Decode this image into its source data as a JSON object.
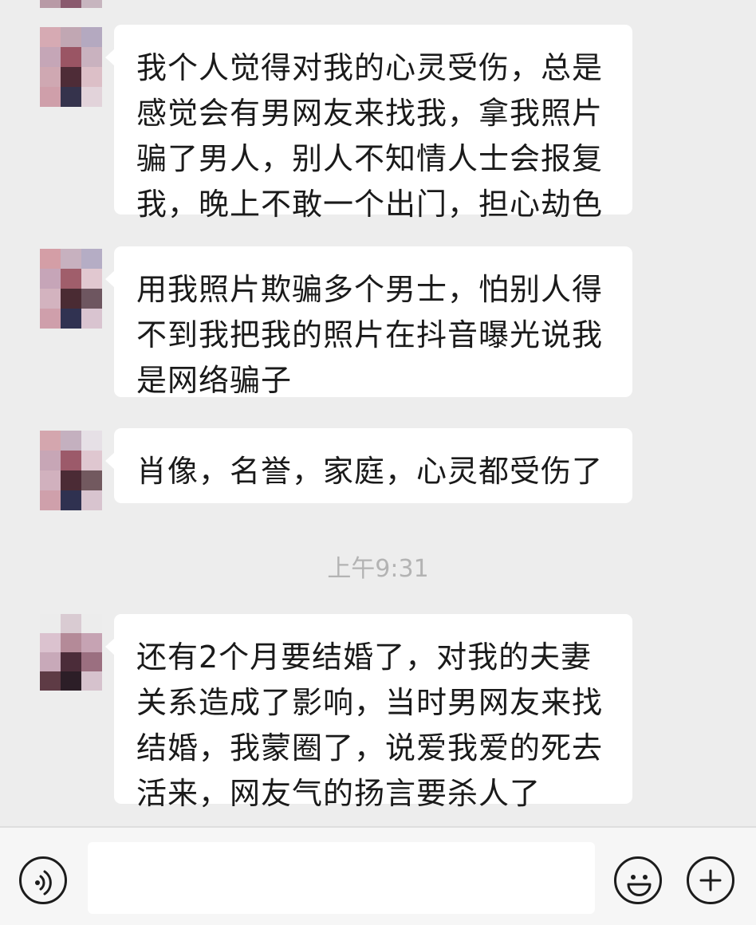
{
  "chat": {
    "messages": [
      {
        "text": "我个人觉得对我的心灵受伤，总是\n感觉会有男网友来找我，拿我照片\n骗了男人，别人不知情人士会报复\n我，晚上不敢一个出门，担心劫色"
      },
      {
        "text": "用我照片欺骗多个男士，怕别人得\n不到我把我的照片在抖音曝光说我\n是网络骗子"
      },
      {
        "text": "肖像，名誉，家庭，心灵都受伤了"
      },
      {
        "text": "还有2个月要结婚了，对我的夫妻\n关系造成了影响，当时男网友来找\n结婚，我蒙圈了，说爱我爱的死去\n活来，网友气的扬言要杀人了"
      }
    ],
    "timestamp": "上午9:31"
  },
  "input_bar": {
    "voice_icon": "voice-icon",
    "emoji_icon": "emoji-icon",
    "plus_icon": "plus-icon",
    "input_value": ""
  },
  "colors": {
    "background": "#ededed",
    "bubble": "#ffffff",
    "text": "#1a1a1a",
    "timestamp": "#b3b3b3",
    "input_bar": "#f6f6f6"
  }
}
